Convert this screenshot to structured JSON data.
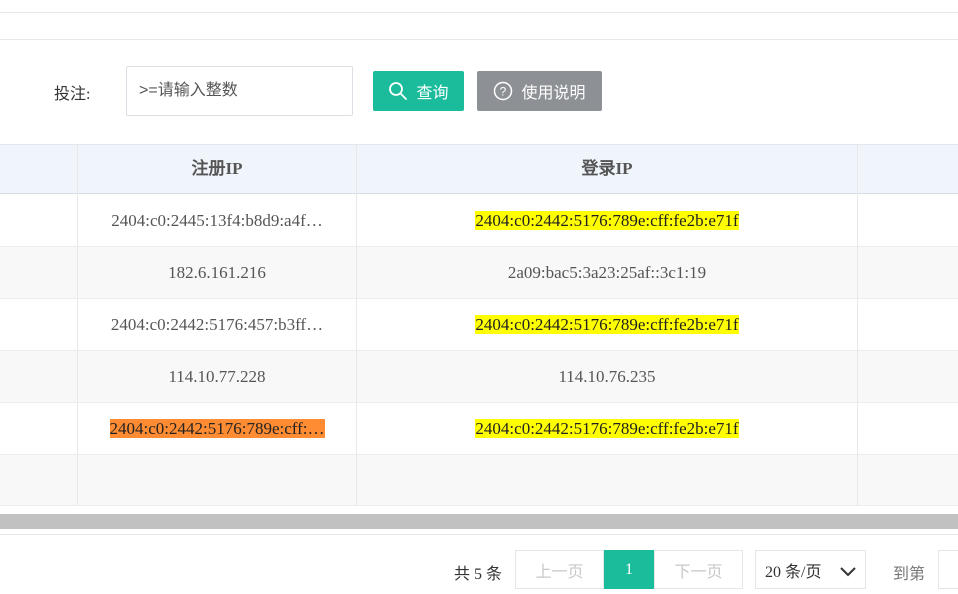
{
  "filter": {
    "label": "投注:",
    "input_placeholder": ">=请输入整数",
    "query_label": "查询",
    "help_label": "使用说明"
  },
  "table": {
    "columns": [
      "注册IP",
      "登录IP"
    ],
    "rows": [
      {
        "reg_ip": "2404:c0:2445:13f4:b8d9:a4f…",
        "reg_hl": "",
        "login_ip": "2404:c0:2442:5176:789e:cff:fe2b:e71f",
        "login_hl": "yellow"
      },
      {
        "reg_ip": "182.6.161.216",
        "reg_hl": "",
        "login_ip": "2a09:bac5:3a23:25af::3c1:19",
        "login_hl": ""
      },
      {
        "reg_ip": "2404:c0:2442:5176:457:b3ff…",
        "reg_hl": "",
        "login_ip": "2404:c0:2442:5176:789e:cff:fe2b:e71f",
        "login_hl": "yellow"
      },
      {
        "reg_ip": "114.10.77.228",
        "reg_hl": "",
        "login_ip": "114.10.76.235",
        "login_hl": ""
      },
      {
        "reg_ip": "2404:c0:2442:5176:789e:cff:…",
        "reg_hl": "orange",
        "login_ip": "2404:c0:2442:5176:789e:cff:fe2b:e71f",
        "login_hl": "yellow"
      }
    ]
  },
  "pagination": {
    "total": "共 5 条",
    "prev": "上一页",
    "current": "1",
    "next": "下一页",
    "page_size": "20 条/页",
    "goto": "到第"
  },
  "colors": {
    "accent": "#1abc9c",
    "help_button": "#8d9095",
    "highlight_yellow": "#ffff00",
    "highlight_orange": "#ff8c33"
  }
}
